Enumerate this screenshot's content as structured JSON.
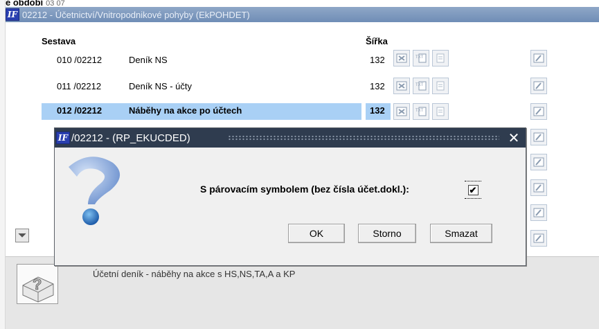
{
  "header": {
    "period_label": "e období",
    "period_value": "03 07"
  },
  "back_window": {
    "title": "02212 - Účetnictví/Vnitropodnikové pohyby (EkPOHDET)",
    "col_sestava": "Sestava",
    "col_sirka": "Šířka",
    "rows": [
      {
        "code": "010 /02212",
        "name": "Deník NS",
        "width": "132"
      },
      {
        "code": "011 /02212",
        "name": "Deník NS - účty",
        "width": "132"
      },
      {
        "code": "012 /02212",
        "name": "Náběhy na akce po účtech",
        "width": "132"
      }
    ]
  },
  "dialog": {
    "title": "/02212 - (RP_EKUCDED)",
    "close_glyph": "✕",
    "label": "S párovacím symbolem (bez čísla účet.dokl.):",
    "checkbox_checked": true,
    "ok": "OK",
    "storno": "Storno",
    "smazat": "Smazat"
  },
  "footer": {
    "help_text": "Účetní deník - náběhy na akce s HS,NS,TA,A a KP"
  },
  "logo_text": "IF",
  "colors": {
    "accent_blue": "#a9d0f5",
    "dialog_title": "#2f3c4f"
  }
}
